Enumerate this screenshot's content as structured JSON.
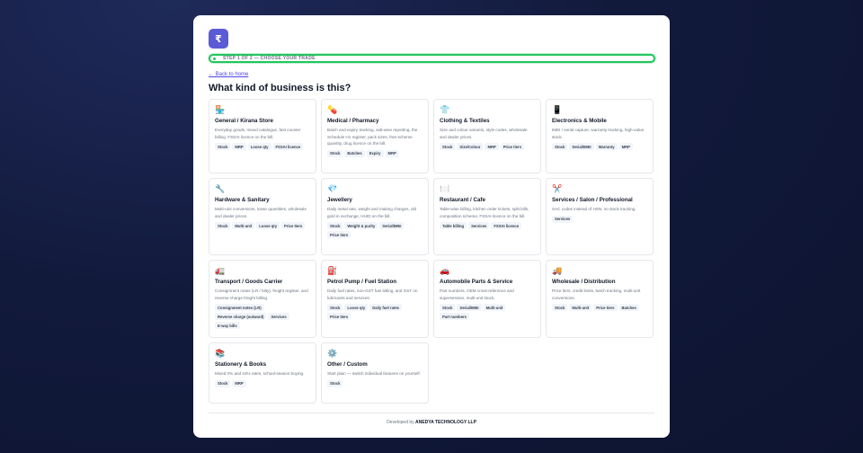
{
  "logo": "₹",
  "step_label": "STEP 1 OF 2 — CHOOSE YOUR TRADE",
  "back_link": "← Back to home",
  "heading": "What kind of business is this?",
  "tiles": [
    {
      "icon": "🏪",
      "name": "General / Kirana Store",
      "desc": "Everyday goods, mixed catalogue, fast counter billing. FSSAI licence on the bill.",
      "tags": [
        "Stock",
        "MRP",
        "Loose qty",
        "FSSAI licence"
      ]
    },
    {
      "icon": "💊",
      "name": "Medical / Pharmacy",
      "desc": "Batch and expiry tracking, salt-wise reporting, the Schedule H1 register, pack sizes, free-scheme quantity, drug licence on the bill.",
      "tags": [
        "Stock",
        "Batches",
        "Expiry",
        "MRP"
      ]
    },
    {
      "icon": "👕",
      "name": "Clothing & Textiles",
      "desc": "Size and colour variants, style codes, wholesale and dealer prices.",
      "tags": [
        "Stock",
        "Size/Colour",
        "MRP",
        "Price tiers"
      ]
    },
    {
      "icon": "📱",
      "name": "Electronics & Mobile",
      "desc": "IMEI / serial capture, warranty tracking, high-value stock.",
      "tags": [
        "Stock",
        "Serial/IMEI",
        "Warranty",
        "MRP"
      ]
    },
    {
      "icon": "🔧",
      "name": "Hardware & Sanitary",
      "desc": "Multi-unit conversions, loose quantities, wholesale and dealer prices.",
      "tags": [
        "Stock",
        "Multi-unit",
        "Loose qty",
        "Price tiers"
      ]
    },
    {
      "icon": "💎",
      "name": "Jewellery",
      "desc": "Daily metal rate, weight and making charges, old gold in exchange, HUID on the bill.",
      "tags": [
        "Stock",
        "Weight & purity",
        "Serial/IMEI",
        "Price tiers"
      ]
    },
    {
      "icon": "🍽️",
      "name": "Restaurant / Cafe",
      "desc": "Table-wise billing, kitchen order tickets, split bills, composition scheme, FSSAI licence on the bill.",
      "tags": [
        "Table billing",
        "Services",
        "FSSAI licence"
      ]
    },
    {
      "icon": "✂️",
      "name": "Services / Salon / Professional",
      "desc": "SAC codes instead of HSN, no stock tracking.",
      "tags": [
        "Services"
      ]
    },
    {
      "icon": "🚛",
      "name": "Transport / Goods Carrier",
      "desc": "Consignment notes (LR / bilty), freight register, and reverse-charge freight billing.",
      "tags": [
        "Consignment notes (LR)",
        "Reverse charge (outward)",
        "Services",
        "E-way bills"
      ]
    },
    {
      "icon": "⛽",
      "name": "Petrol Pump / Fuel Station",
      "desc": "Daily fuel rates, non-GST fuel billing, and GST on lubricants and services.",
      "tags": [
        "Stock",
        "Loose qty",
        "Daily fuel rates",
        "Price tiers"
      ]
    },
    {
      "icon": "🚗",
      "name": "Automobile Parts & Service",
      "desc": "Part numbers, OEM cross-reference and supersession, multi-unit stock.",
      "tags": [
        "Stock",
        "Serial/IMEI",
        "Multi-unit",
        "Part numbers"
      ]
    },
    {
      "icon": "🚚",
      "name": "Wholesale / Distribution",
      "desc": "Price tiers, credit limits, batch tracking, multi-unit conversions.",
      "tags": [
        "Stock",
        "Multi-unit",
        "Price tiers",
        "Batches"
      ]
    },
    {
      "icon": "📚",
      "name": "Stationery & Books",
      "desc": "Mixed 0% and 18% rates, school-season buying.",
      "tags": [
        "Stock",
        "MRP"
      ]
    },
    {
      "icon": "⚙️",
      "name": "Other / Custom",
      "desc": "Start plain — switch individual features on yourself.",
      "tags": [
        "Stock"
      ]
    }
  ],
  "footer": {
    "prefix": "Developed by",
    "company": "ANEDYA TECHNOLOGY LLP"
  }
}
